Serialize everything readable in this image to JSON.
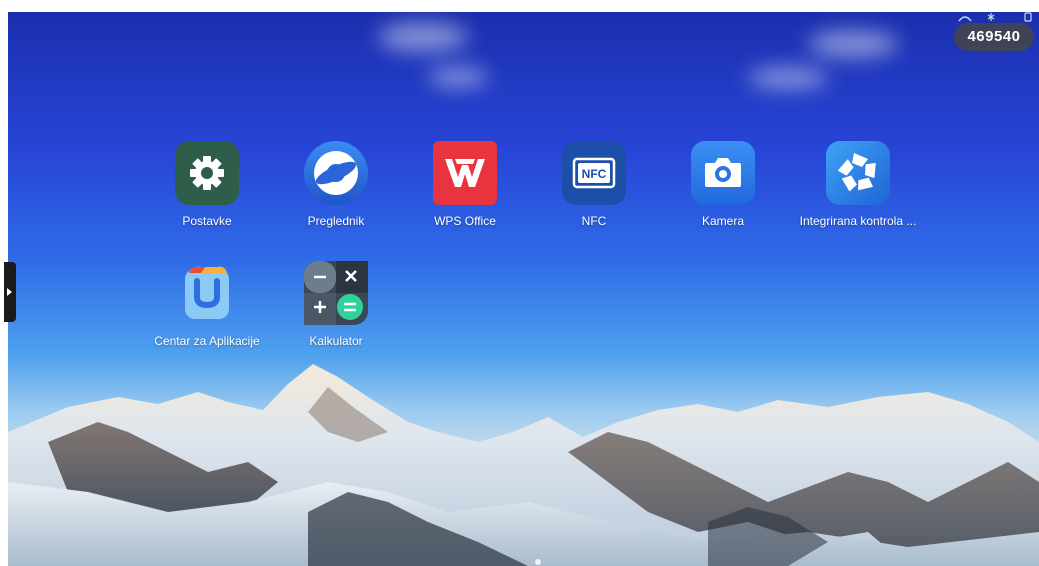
{
  "device_id_badge": "469540",
  "apps": [
    {
      "label": "Postavke",
      "icon": "gear-icon",
      "color": "#2e5e4a"
    },
    {
      "label": "Preglednik",
      "icon": "browser-icon",
      "color": "#2c6fe0"
    },
    {
      "label": "WPS Office",
      "icon": "wps-office-icon",
      "color": "#e8343f"
    },
    {
      "label": "NFC",
      "icon": "nfc-icon",
      "color": "#1b4fa8"
    },
    {
      "label": "Kamera",
      "icon": "camera-icon",
      "color": "#2f7ef0"
    },
    {
      "label": "Integrirana kontrola ...",
      "icon": "integrated-control-icon",
      "color": "#2a7de8"
    },
    {
      "label": "Centar za Aplikacije",
      "icon": "app-center-icon",
      "color": "#6fb6f0"
    },
    {
      "label": "Kalkulator",
      "icon": "calculator-icon",
      "color": "#3b4754"
    }
  ],
  "nfc_icon_text": "NFC"
}
